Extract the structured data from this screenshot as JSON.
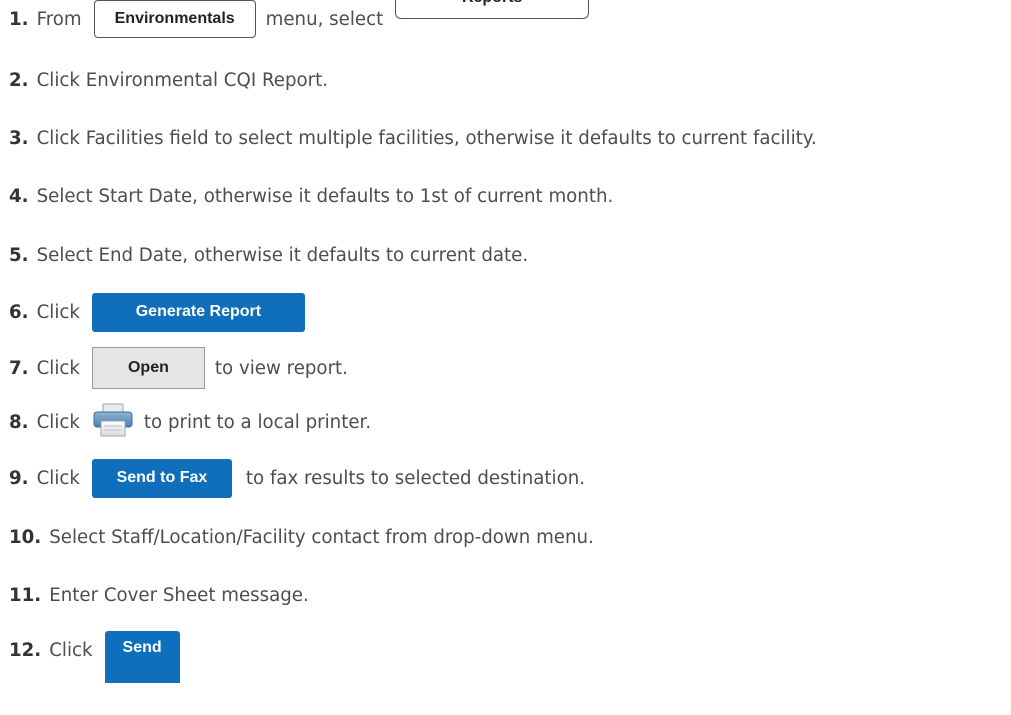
{
  "steps": [
    {
      "number": "1.",
      "text_before": "From",
      "menu_label": "Environmentals",
      "text_middle": "menu, select",
      "item_label": "Reports"
    },
    {
      "number": "2.",
      "text": "Click Environmental CQI Report."
    },
    {
      "number": "3.",
      "text": "Click Facilities field to select multiple facilities, otherwise it defaults to current facility."
    },
    {
      "number": "4.",
      "text": "Select Start Date, otherwise it defaults to 1st of current month."
    },
    {
      "number": "5.",
      "text": "Select End Date, otherwise it defaults to current date."
    },
    {
      "number": "6.",
      "text_before": "Click",
      "button_label": "Generate Report"
    },
    {
      "number": "7.",
      "text_before": "Click",
      "button_label": "Open",
      "text_after": "to view report."
    },
    {
      "number": "8.",
      "text_before": "Click",
      "icon": "printer-icon",
      "text_after": "to print to a local printer."
    },
    {
      "number": "9.",
      "text_before": "Click",
      "button_label": "Send to Fax",
      "text_after": "to  fax results to selected destination."
    },
    {
      "number": "10.",
      "text": "Select Staff/Location/Facility contact from drop-down menu."
    },
    {
      "number": "11.",
      "text": "Enter Cover Sheet message."
    },
    {
      "number": "12.",
      "text_before": "Click",
      "button_label": "Send"
    }
  ],
  "colors": {
    "button_blue": "#0f6fbd",
    "button_grey": "#e5e5e5",
    "body_text": "#4d4d4d",
    "number_text": "#333333"
  }
}
